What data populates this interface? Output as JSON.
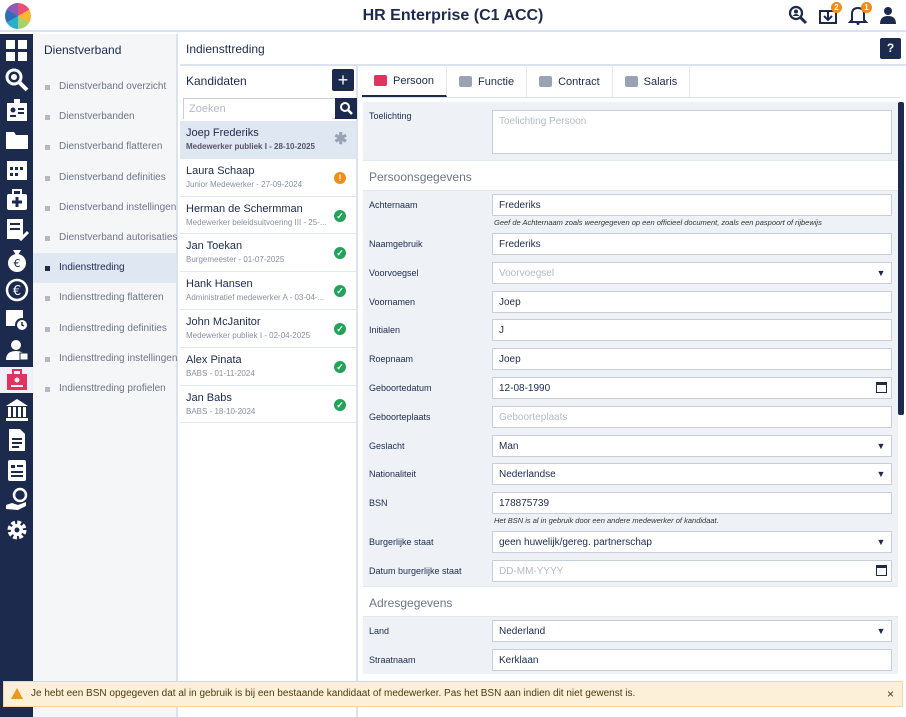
{
  "app": {
    "title": "HR Enterprise (C1 ACC)",
    "notification_count": "2",
    "alert_count": "1"
  },
  "submenu": {
    "title": "Dienstverband",
    "items": [
      {
        "label": "Dienstverband overzicht"
      },
      {
        "label": "Dienstverbanden"
      },
      {
        "label": "Dienstverband flatteren"
      },
      {
        "label": "Dienstverband definities"
      },
      {
        "label": "Dienstverband instellingen"
      },
      {
        "label": "Dienstverband autorisaties"
      },
      {
        "label": "Indiensttreding"
      },
      {
        "label": "Indiensttreding flatteren"
      },
      {
        "label": "Indiensttreding definities"
      },
      {
        "label": "Indiensttreding instellingen"
      },
      {
        "label": "Indiensttreding profielen"
      }
    ]
  },
  "page": {
    "title": "Indiensttreding",
    "help_label": "?"
  },
  "candidates": {
    "title": "Kandidaten",
    "add_label": "+",
    "search_placeholder": "Zoeken",
    "items": [
      {
        "name": "Joep Frederiks",
        "sub": "Medewerker publiek I - 28-10-2025",
        "status": "new",
        "glyph": "✱"
      },
      {
        "name": "Laura Schaap",
        "sub": "Junior Medewerker - 27-09-2024",
        "status": "warn",
        "glyph": "!"
      },
      {
        "name": "Herman de Schermman",
        "sub": "Medewerker beleidsuitvoering III - 25-...",
        "status": "ok",
        "glyph": "✓"
      },
      {
        "name": "Jan Toekan",
        "sub": "Burgemeester - 01-07-2025",
        "status": "ok",
        "glyph": "✓"
      },
      {
        "name": "Hank Hansen",
        "sub": "Administratief medewerker A - 03-04-...",
        "status": "ok",
        "glyph": "✓"
      },
      {
        "name": "John McJanitor",
        "sub": "Medewerker publiek I - 02-04-2025",
        "status": "ok",
        "glyph": "✓"
      },
      {
        "name": "Alex Pinata",
        "sub": "BABS - 01-11-2024",
        "status": "ok",
        "glyph": "✓"
      },
      {
        "name": "Jan Babs",
        "sub": "BABS - 18-10-2024",
        "status": "ok",
        "glyph": "✓"
      }
    ]
  },
  "tabs": [
    {
      "label": "Persoon"
    },
    {
      "label": "Functie"
    },
    {
      "label": "Contract"
    },
    {
      "label": "Salaris"
    }
  ],
  "form": {
    "toelichting": {
      "label": "Toelichting",
      "placeholder": "Toelichting Persoon"
    },
    "section_person": "Persoonsgegevens",
    "achternaam": {
      "label": "Achternaam",
      "value": "Frederiks",
      "hint": "Geef de Achternaam zoals weergegeven op een officieel document, zoals een paspoort of rijbewijs"
    },
    "naamgebruik": {
      "label": "Naamgebruik",
      "value": "Frederiks"
    },
    "voorvoegsel": {
      "label": "Voorvoegsel",
      "placeholder": "Voorvoegsel"
    },
    "voornamen": {
      "label": "Voornamen",
      "value": "Joep"
    },
    "initialen": {
      "label": "Initialen",
      "value": "J"
    },
    "roepnaam": {
      "label": "Roepnaam",
      "value": "Joep"
    },
    "geboortedatum": {
      "label": "Geboortedatum",
      "value": "12-08-1990"
    },
    "geboorteplaats": {
      "label": "Geboorteplaats",
      "placeholder": "Geboorteplaats"
    },
    "geslacht": {
      "label": "Geslacht",
      "value": "Man"
    },
    "nationaliteit": {
      "label": "Nationaliteit",
      "value": "Nederlandse"
    },
    "bsn": {
      "label": "BSN",
      "value": "178875739",
      "hint": "Het BSN is al in gebruik door een andere medewerker of kandidaat."
    },
    "burgerlijke_staat": {
      "label": "Burgerlijke staat",
      "value": "geen huwelijk/gereg. partnerschap"
    },
    "datum_burgerlijke_staat": {
      "label": "Datum burgerlijke staat",
      "placeholder": "DD-MM-YYYY"
    },
    "section_address": "Adresgegevens",
    "land": {
      "label": "Land",
      "value": "Nederland"
    },
    "straatnaam": {
      "label": "Straatnaam",
      "value": "Kerklaan"
    }
  },
  "alert": {
    "text": "Je hebt een BSN opgegeven dat al in gebruik is bij een bestaande kandidaat of medewerker. Pas het BSN aan indien dit niet gewenst is.",
    "close_label": "×"
  },
  "colors": {
    "navy": "#1c2a4d",
    "accent": "#e0335f",
    "ok": "#22a35a",
    "warn": "#f08c1a",
    "alert_bg": "#fdf0d8"
  },
  "icons": {
    "top": [
      "search-user-icon",
      "inbox-icon",
      "bell-icon",
      "user-icon"
    ],
    "nav": [
      "dashboard-icon",
      "search-icon",
      "badge-icon",
      "folder-icon",
      "calendar-icon",
      "medical-kit-icon",
      "checklist-icon",
      "money-bag-icon",
      "euro-icon",
      "calendar-clock-icon",
      "person-card-icon",
      "employment-icon",
      "bank-icon",
      "document-icon",
      "report-icon",
      "hand-coin-icon",
      "gear-icon"
    ]
  }
}
